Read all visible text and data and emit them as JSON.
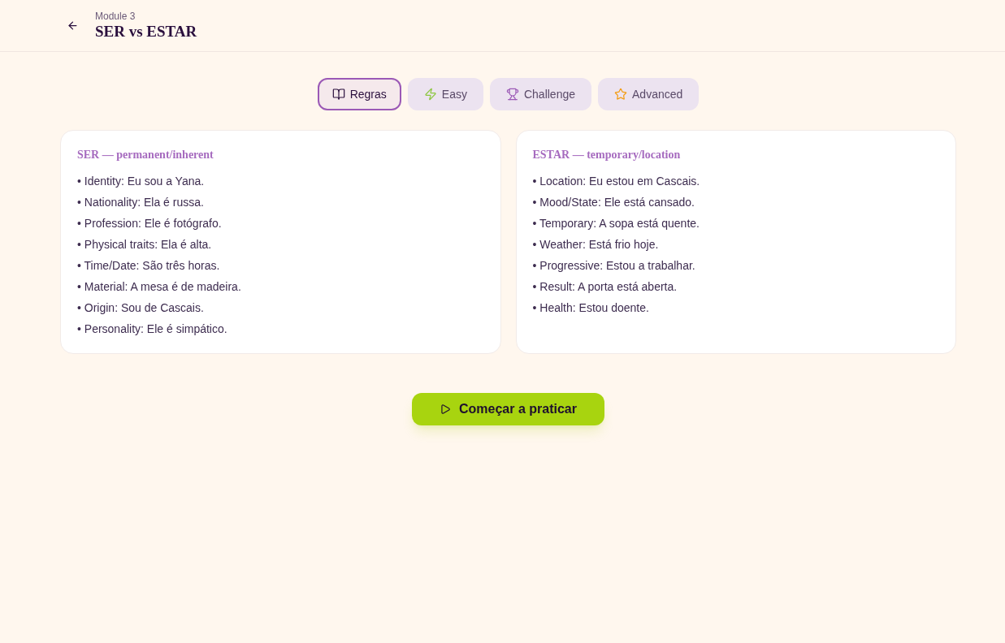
{
  "header": {
    "eyebrow": "Module 3",
    "title": "SER vs ESTAR"
  },
  "tabs": [
    {
      "label": "Regras",
      "kind": "book",
      "selected": true
    },
    {
      "label": "Easy",
      "kind": "bolt",
      "selected": false
    },
    {
      "label": "Challenge",
      "kind": "trophy",
      "selected": false
    },
    {
      "label": "Advanced",
      "kind": "star",
      "selected": false
    }
  ],
  "cards": [
    {
      "heading": "SER — permanent/inherent",
      "items": [
        "• Identity: Eu sou a Yana.",
        "• Nationality: Ela é russa.",
        "• Profession: Ele é fotógrafo.",
        "• Physical traits: Ela é alta.",
        "• Time/Date: São três horas.",
        "• Material: A mesa é de madeira.",
        "• Origin: Sou de Cascais.",
        "• Personality: Ele é simpático."
      ]
    },
    {
      "heading": "ESTAR — temporary/location",
      "items": [
        "• Location: Eu estou em Cascais.",
        "• Mood/State: Ele está cansado.",
        "• Temporary: A sopa está quente.",
        "• Weather: Está frio hoje.",
        "• Progressive: Estou a trabalhar.",
        "• Result: A porta está aberta.",
        "• Health: Estou doente."
      ]
    }
  ],
  "start_button": {
    "label": "Começar a praticar"
  }
}
